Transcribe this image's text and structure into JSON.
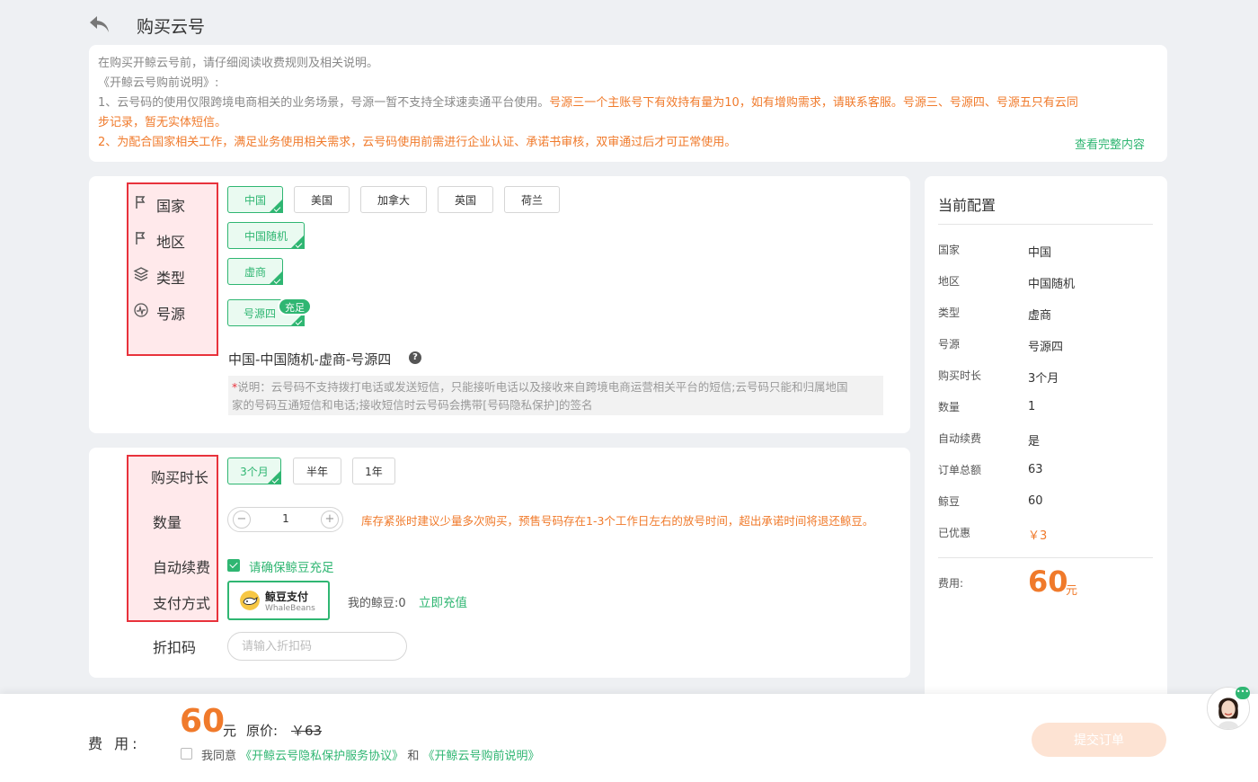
{
  "header": {
    "title": "购买云号",
    "back_icon": "back-arrow-icon"
  },
  "notice": {
    "line1": "在购买开鲸云号前，请仔细阅读收费规则及相关说明。",
    "line2": "《开鲸云号购前说明》:",
    "line3_gray": "1、云号码的使用仅限跨境电商相关的业务场景，号源一暂不支持全球速卖通平台使用。",
    "line3_orange": "号源三一个主账号下有效持有量为10，如有增购需求，请联系客服。号源三、号源四、号源五只有云同",
    "line4_orange": "步记录，暂无实体短信。",
    "line5_orange": "2、为配合国家相关工作，满足业务使用相关需求，云号码使用前需进行企业认证、承诺书审核，双审通过后才可正常使用。",
    "more_link": "查看完整内容"
  },
  "config": {
    "labels": {
      "country": "国家",
      "region": "地区",
      "type": "类型",
      "source": "号源"
    },
    "countries": [
      "中国",
      "美国",
      "加拿大",
      "英国",
      "荷兰"
    ],
    "selected_country": "中国",
    "region": "中国随机",
    "type": "虚商",
    "source": "号源四",
    "source_badge": "充足",
    "summary": "中国-中国随机-虚商-号源四",
    "help_icon": "?",
    "desc_star": "*",
    "desc_line1": "说明：云号码不支持拨打电话或发送短信，只能接听电话以及接收来自跨境电商运营相关平台的短信;云号码只能和归属地国",
    "desc_line2": "家的号码互通短信和电话;接收短信时云号码会携带[号码隐私保护]的签名"
  },
  "purchase": {
    "labels": {
      "duration": "购买时长",
      "quantity": "数量",
      "auto_renew": "自动续费",
      "payment": "支付方式",
      "discount": "折扣码"
    },
    "durations": [
      "3个月",
      "半年",
      "1年"
    ],
    "selected_duration": "3个月",
    "quantity": "1",
    "minus": "−",
    "plus": "+",
    "qty_tip": "库存紧张时建议少量多次购买，预售号码存在1-3个工作日左右的放号时间，超出承诺时间将退还鲸豆。",
    "auto_renew_text": "请确保鲸豆充足",
    "pay_title": "鲸豆支付",
    "pay_sub": "WhaleBeans",
    "balance": "我的鲸豆:0",
    "recharge": "立即充值",
    "discount_placeholder": "请输入折扣码"
  },
  "side": {
    "title": "当前配置",
    "rows": [
      {
        "key": "国家",
        "value": "中国"
      },
      {
        "key": "地区",
        "value": "中国随机"
      },
      {
        "key": "类型",
        "value": "虚商"
      },
      {
        "key": "号源",
        "value": "号源四"
      },
      {
        "key": "购买时长",
        "value": "3个月"
      },
      {
        "key": "数量",
        "value": "1"
      },
      {
        "key": "自动续费",
        "value": "是"
      },
      {
        "key": "订单总额",
        "value": "63"
      },
      {
        "key": "鲸豆",
        "value": "60"
      },
      {
        "key": "已优惠",
        "value": "￥3"
      }
    ],
    "fee_label": "费用:",
    "fee_value": "60",
    "fee_unit": "元"
  },
  "footer": {
    "fee_label": "费 用:",
    "price": "60",
    "unit": "元",
    "orig_label": "原价:",
    "orig_price": "￥63",
    "agree_prefix": "我同意",
    "agree_link1": "《开鲸云号隐私保护服务协议》",
    "agree_and": "和",
    "agree_link2": "《开鲸云号购前说明》",
    "submit": "提交订单"
  },
  "colors": {
    "accent_green": "#2fb672",
    "accent_orange": "#f07a2b",
    "highlight_red": "#e8323c"
  }
}
